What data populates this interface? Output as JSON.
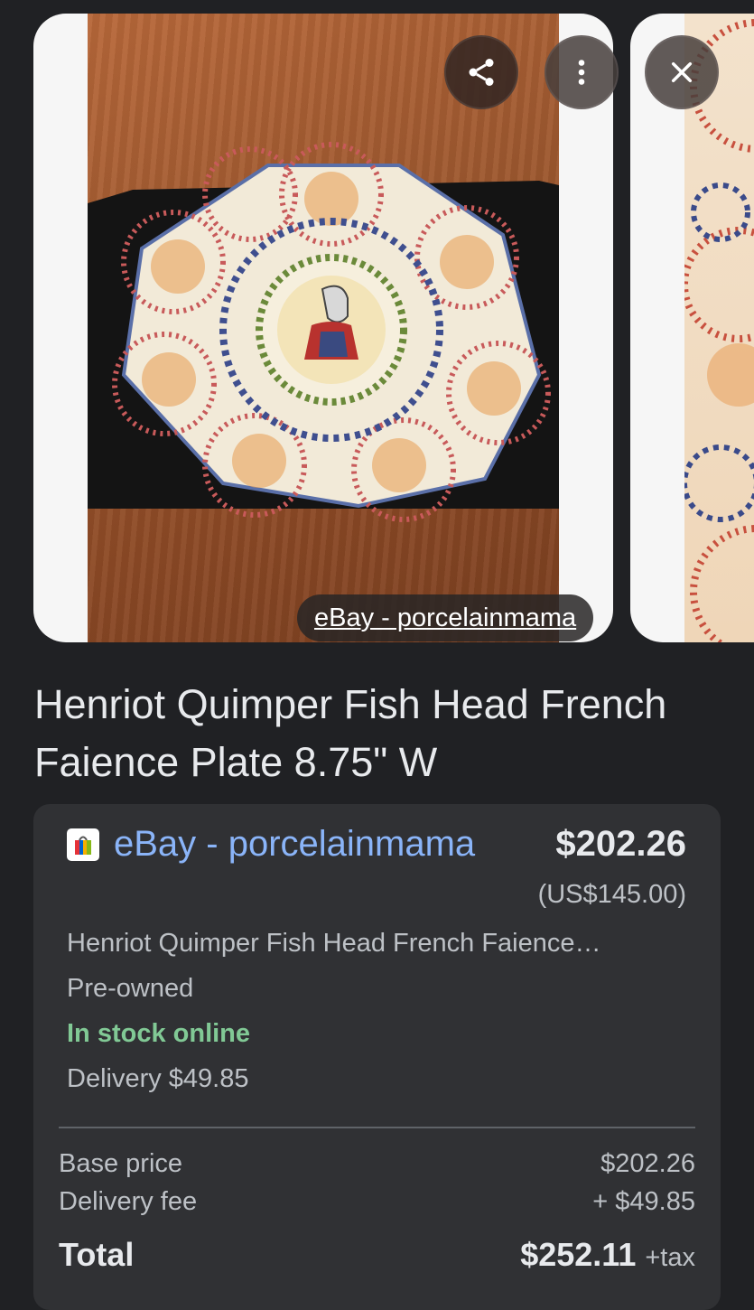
{
  "image": {
    "source_chip": "eBay - porcelainmama"
  },
  "buttons": {
    "share_icon": "share-icon",
    "more_icon": "more-vert-icon",
    "close_icon": "close-icon"
  },
  "product": {
    "title": "Henriot Quimper Fish Head French Faience Plate 8.75\" W"
  },
  "offer": {
    "seller": "eBay - porcelainmama",
    "price": "$202.26",
    "price_usd": "(US$145.00)",
    "description": "Henriot Quimper Fish Head French Faience…",
    "condition": "Pre-owned",
    "stock": "In stock online",
    "delivery": "Delivery $49.85",
    "colors": {
      "seller_link": "#8ab4f8",
      "in_stock": "#81c995"
    }
  },
  "summary": {
    "base_price_label": "Base price",
    "base_price_value": "$202.26",
    "delivery_fee_label": "Delivery fee",
    "delivery_fee_value": "+ $49.85",
    "total_label": "Total",
    "total_value": "$252.11",
    "tax_note": "+tax"
  }
}
